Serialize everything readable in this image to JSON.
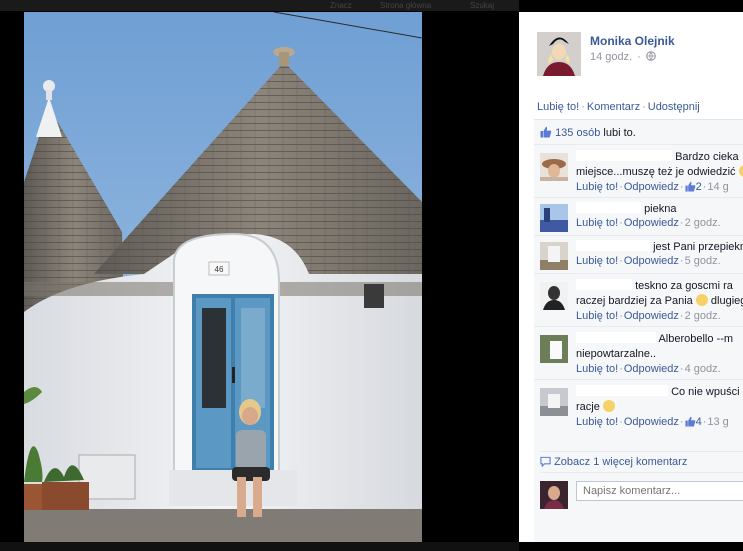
{
  "topbar": {
    "ghost_items": [
      "Znacz",
      "Strona główna",
      "Szukaj"
    ]
  },
  "post": {
    "author": "Monika Olejnik",
    "time": "14 godz.",
    "privacy_icon": "globe-icon",
    "door_number": "46",
    "actions": {
      "like": "Lubię to!",
      "comment": "Komentarz",
      "share": "Udostępnij"
    }
  },
  "likes": {
    "count": "135 osób",
    "suffix": "lubi to."
  },
  "comments": [
    {
      "text1": "Bardzo cieka",
      "text2": "miejsce...muszę też je odwiedzić",
      "like": "Lubię to!",
      "reply": "Odpowiedz",
      "likes": "2",
      "age": "14 g"
    },
    {
      "text1": "piekna",
      "text2": "",
      "like": "Lubię to!",
      "reply": "Odpowiedz",
      "likes": "",
      "age": "2 godz."
    },
    {
      "text1": "jest Pani przepiekn",
      "text2": "",
      "like": "Lubię to!",
      "reply": "Odpowiedz",
      "likes": "",
      "age": "5 godz."
    },
    {
      "text1": "teskno za goscmi ra",
      "text2": "raczej bardziej za Pania",
      "text3": "dlugiego",
      "like": "Lubię to!",
      "reply": "Odpowiedz",
      "likes": "",
      "age": "2 godz."
    },
    {
      "text1": "Alberobello --m",
      "text2": "niepowtarzalne..",
      "like": "Lubię to!",
      "reply": "Odpowiedz",
      "likes": "",
      "age": "4 godz."
    },
    {
      "text1": "Co nie wpuści",
      "text2": "racje",
      "like": "Lubię to!",
      "reply": "Odpowiedz",
      "likes": "4",
      "age": "13 g"
    }
  ],
  "more_comments": "Zobacz 1 więcej komentarz",
  "write_placeholder": "Napisz komentarz...",
  "colors": {
    "link": "#3b5998",
    "muted": "#90949c",
    "ufi_bg": "#f6f7f9",
    "door": "#4f8fb8"
  }
}
